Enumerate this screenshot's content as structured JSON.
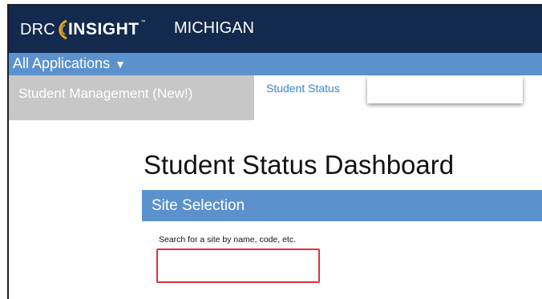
{
  "brand": {
    "logo_prefix": "DRC",
    "logo_name": "INSIGHT",
    "logo_tm": "™",
    "state": "MICHIGAN",
    "colors": {
      "navy": "#13294d",
      "blue": "#5b92cd",
      "gold": "#e2a726"
    }
  },
  "appbar": {
    "menu_label": "All Applications",
    "menu_caret": "▼"
  },
  "tabs": [
    {
      "label": "Student Management (New!)"
    },
    {
      "label": "Student Status"
    }
  ],
  "page": {
    "title": "Student Status Dashboard"
  },
  "site_selection": {
    "header": "Site Selection",
    "search_label": "Search for a site by name, code, etc.",
    "search_value": ""
  }
}
